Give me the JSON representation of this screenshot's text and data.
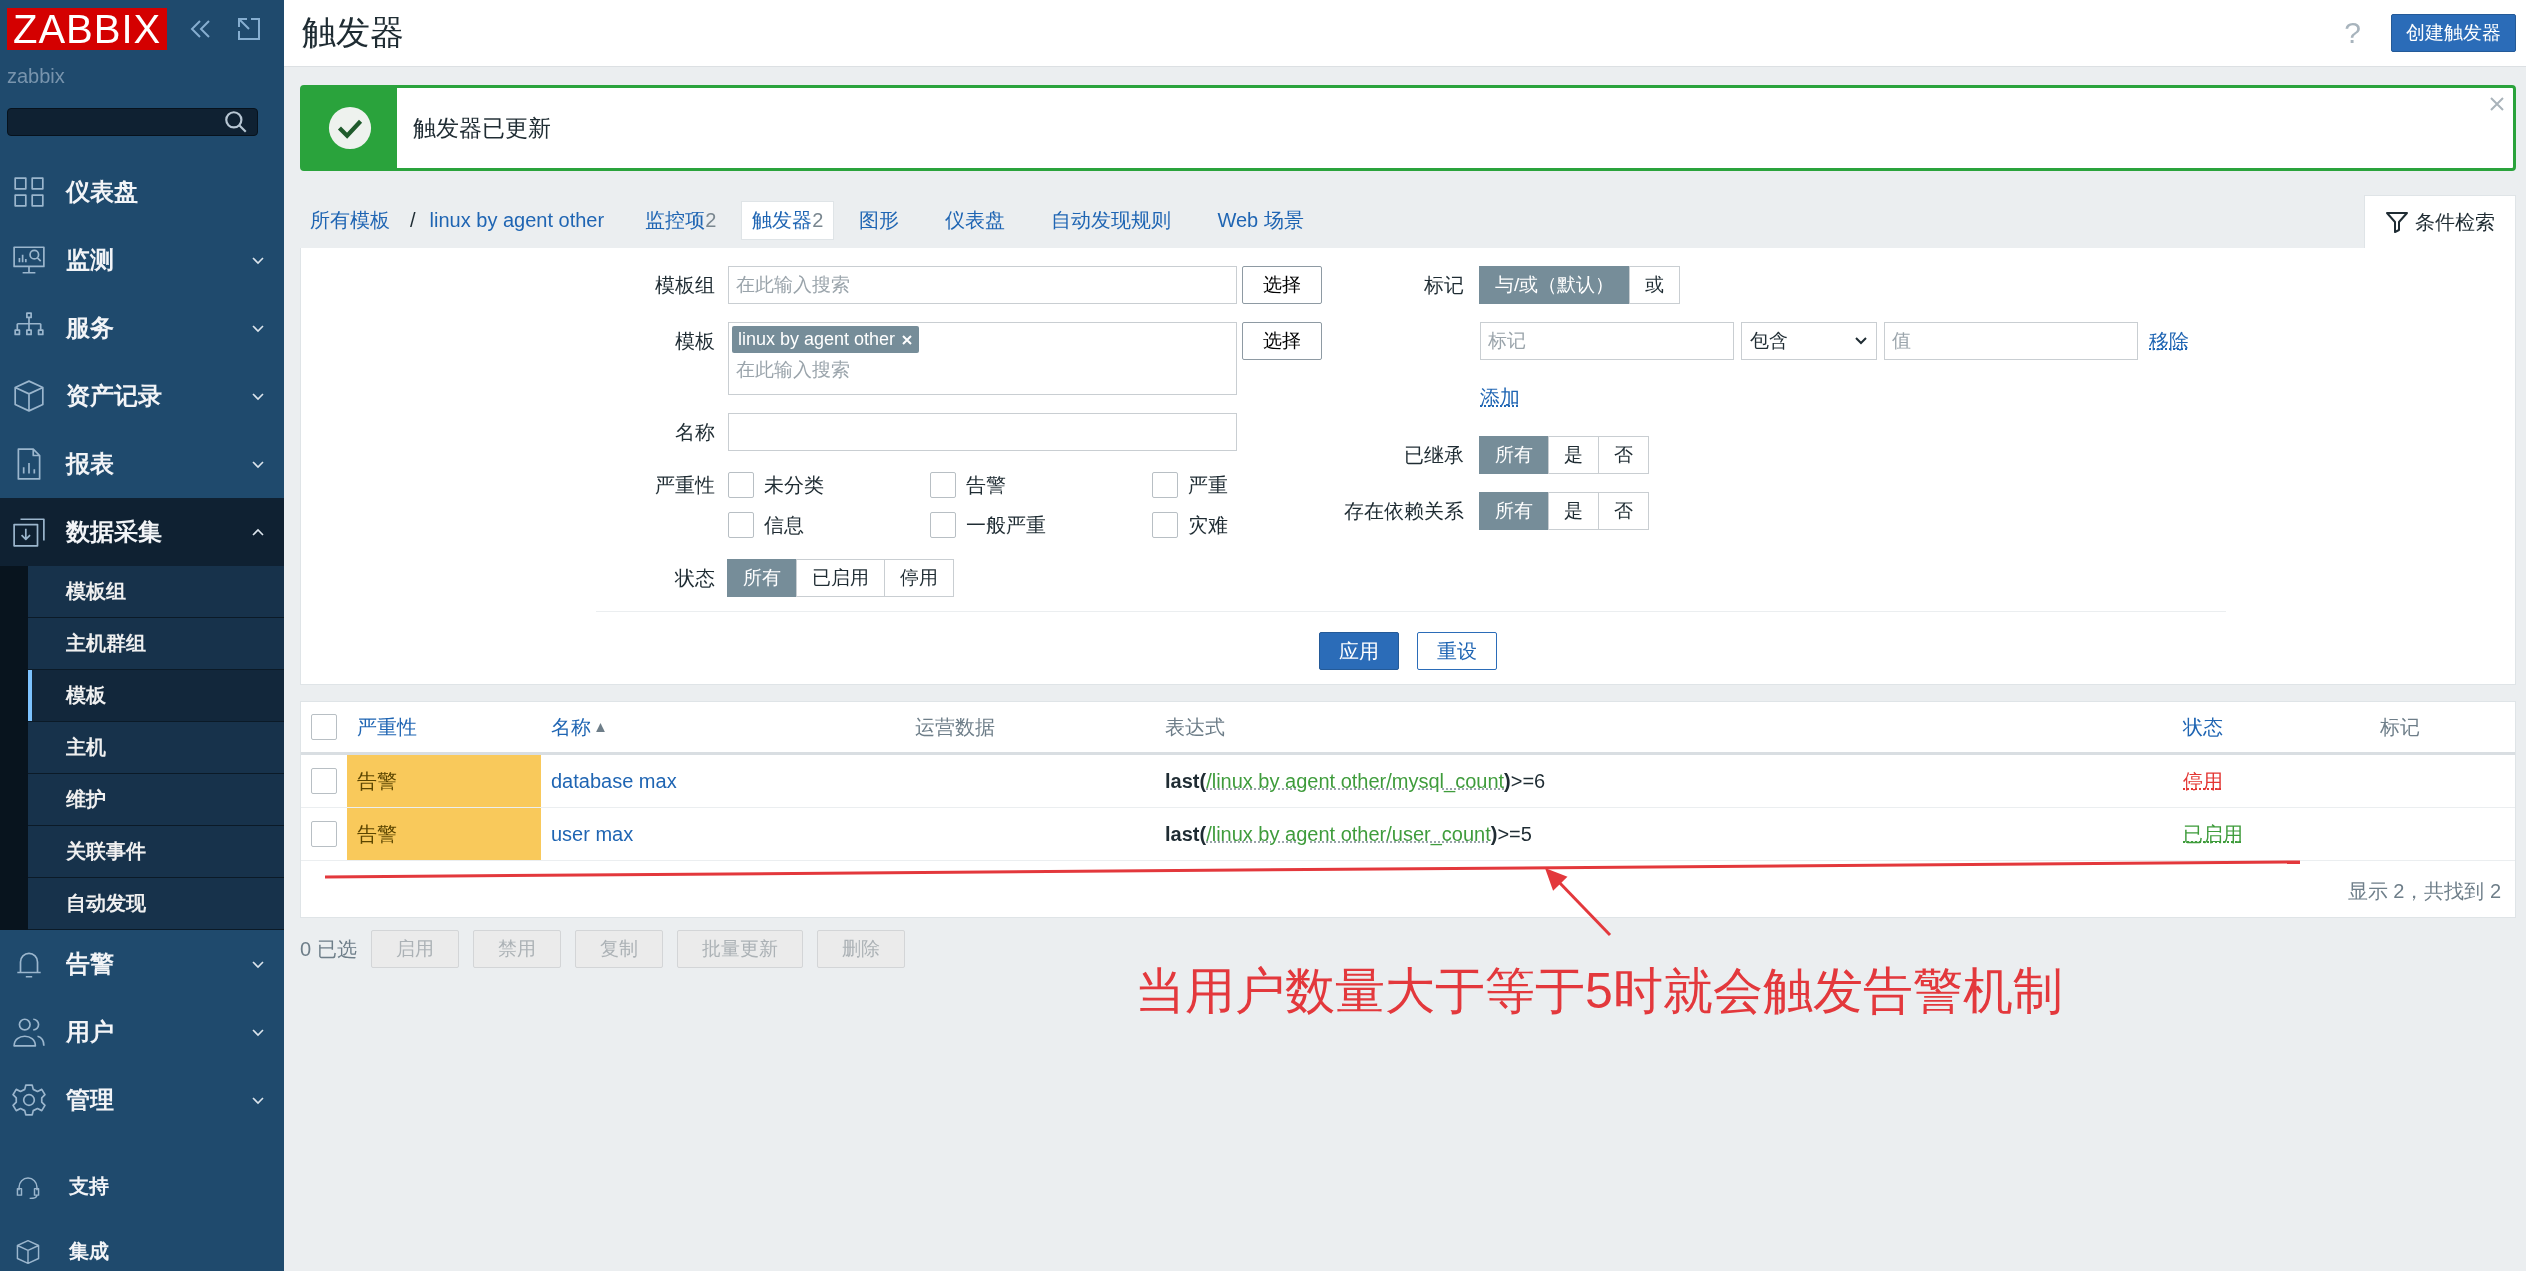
{
  "brand": {
    "logo": "ZABBIX",
    "user": "zabbix"
  },
  "sidebar": {
    "items": [
      {
        "label": "仪表盘",
        "kind": "link",
        "expanded": false
      },
      {
        "label": "监测",
        "kind": "group",
        "expanded": false
      },
      {
        "label": "服务",
        "kind": "group",
        "expanded": false
      },
      {
        "label": "资产记录",
        "kind": "group",
        "expanded": false
      },
      {
        "label": "报表",
        "kind": "group",
        "expanded": false
      },
      {
        "label": "数据采集",
        "kind": "group",
        "expanded": true,
        "children": [
          {
            "label": "模板组",
            "selected": false
          },
          {
            "label": "主机群组",
            "selected": false
          },
          {
            "label": "模板",
            "selected": true
          },
          {
            "label": "主机",
            "selected": false
          },
          {
            "label": "维护",
            "selected": false
          },
          {
            "label": "关联事件",
            "selected": false
          },
          {
            "label": "自动发现",
            "selected": false
          }
        ]
      },
      {
        "label": "告警",
        "kind": "group",
        "expanded": false
      },
      {
        "label": "用户",
        "kind": "group",
        "expanded": false
      },
      {
        "label": "管理",
        "kind": "group",
        "expanded": false
      }
    ],
    "footer_items": [
      {
        "label": "支持"
      },
      {
        "label": "集成"
      }
    ]
  },
  "header": {
    "title": "触发器",
    "help": "?",
    "create_button": "创建触发器"
  },
  "message": {
    "kind": "success",
    "text": "触发器已更新"
  },
  "breadcrumbs": {
    "items": [
      "所有模板",
      "linux by agent other"
    ],
    "separator": "/"
  },
  "tabs": [
    {
      "label": "监控项",
      "count": "2",
      "selected": false
    },
    {
      "label": "触发器",
      "count": "2",
      "selected": true
    },
    {
      "label": "图形",
      "selected": false
    },
    {
      "label": "仪表盘",
      "selected": false
    },
    {
      "label": "自动发现规则",
      "selected": false
    },
    {
      "label": "Web 场景",
      "selected": false
    }
  ],
  "filter_tab": {
    "label": "条件检索",
    "selected": true
  },
  "filter": {
    "template_group": {
      "label": "模板组",
      "placeholder": "在此输入搜索",
      "button": "选择"
    },
    "template": {
      "label": "模板",
      "chips": [
        "linux by agent other"
      ],
      "placeholder": "在此输入搜索",
      "button": "选择"
    },
    "name": {
      "label": "名称"
    },
    "severity": {
      "label": "严重性",
      "options": [
        {
          "label": "未分类",
          "checked": false
        },
        {
          "label": "告警",
          "checked": false
        },
        {
          "label": "严重",
          "checked": false
        },
        {
          "label": "信息",
          "checked": false
        },
        {
          "label": "一般严重",
          "checked": false
        },
        {
          "label": "灾难",
          "checked": false
        }
      ]
    },
    "status": {
      "label": "状态",
      "options": [
        {
          "label": "所有",
          "selected": true
        },
        {
          "label": "已启用",
          "selected": false
        },
        {
          "label": "停用",
          "selected": false
        }
      ]
    },
    "tags": {
      "label": "标记",
      "operator": [
        {
          "label": "与/或（默认）",
          "selected": true
        },
        {
          "label": "或",
          "selected": false
        }
      ],
      "rows": [
        {
          "tag_placeholder": "标记",
          "operator": "包含",
          "value_placeholder": "值",
          "remove": "移除"
        }
      ],
      "add": "添加"
    },
    "inherited": {
      "label": "已继承",
      "options": [
        {
          "label": "所有",
          "selected": true
        },
        {
          "label": "是",
          "selected": false
        },
        {
          "label": "否",
          "selected": false
        }
      ]
    },
    "dependencies": {
      "label": "存在依赖关系",
      "options": [
        {
          "label": "所有",
          "selected": true
        },
        {
          "label": "是",
          "selected": false
        },
        {
          "label": "否",
          "selected": false
        }
      ]
    },
    "apply": "应用",
    "reset": "重设"
  },
  "table": {
    "select_all": {
      "checked": false
    },
    "columns": [
      {
        "label": "严重性",
        "sortable": true,
        "sorted": false
      },
      {
        "label": "名称",
        "sortable": true,
        "sorted": true
      },
      {
        "label": "运营数据",
        "sortable": false,
        "sorted": false
      },
      {
        "label": "表达式",
        "sortable": false,
        "sorted": false
      },
      {
        "label": "状态",
        "sortable": true,
        "sorted": false
      },
      {
        "label": "标记",
        "sortable": false,
        "sorted": false
      }
    ],
    "rows": [
      {
        "checked": false,
        "severity": "告警",
        "color": "#f9c95b",
        "name": "database max",
        "expression": [
          {
            "text": "last(",
            "kind": "func"
          },
          {
            "text": "/linux by agent other/mysql_count",
            "kind": "item"
          },
          {
            "text": ")",
            "kind": "func"
          },
          {
            "text": ">=6",
            "kind": "plain"
          }
        ],
        "status": {
          "label": "停用",
          "kind": "disabled"
        }
      },
      {
        "checked": false,
        "severity": "告警",
        "color": "#f9c95b",
        "name": "user max",
        "expression": [
          {
            "text": "last(",
            "kind": "func"
          },
          {
            "text": "/linux by agent other/user_count",
            "kind": "item"
          },
          {
            "text": ")",
            "kind": "func"
          },
          {
            "text": ">=5",
            "kind": "plain"
          }
        ],
        "status": {
          "label": "已启用",
          "kind": "enabled"
        }
      }
    ],
    "footer": "显示 2，共找到 2"
  },
  "actions": {
    "selected_count": "0 已选",
    "buttons": [
      {
        "label": "启用",
        "disabled": true
      },
      {
        "label": "禁用",
        "disabled": true
      },
      {
        "label": "复制",
        "disabled": true
      },
      {
        "label": "批量更新",
        "disabled": true
      },
      {
        "label": "删除",
        "disabled": true
      }
    ]
  },
  "annotation": {
    "text": "当用户数量大于等于5时就会触发告警机制"
  }
}
